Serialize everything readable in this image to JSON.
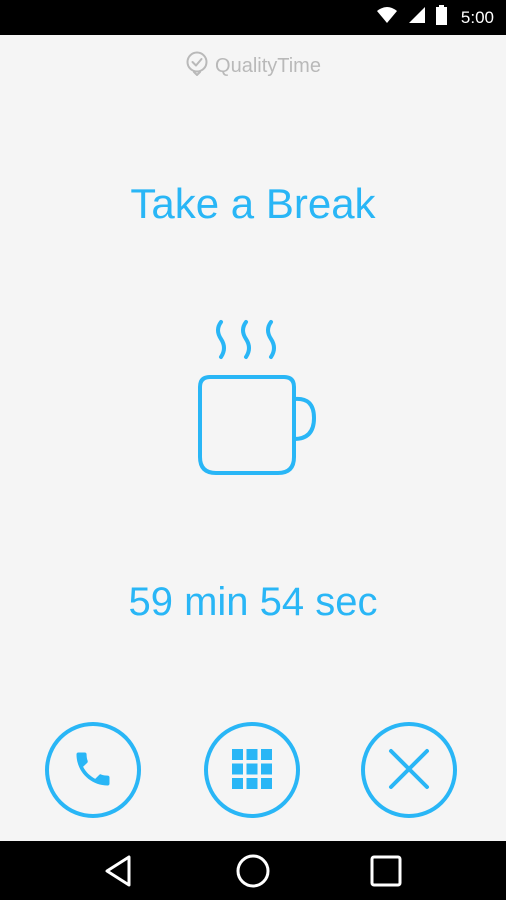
{
  "status_bar": {
    "time": "5:00",
    "icons": [
      "wifi-icon",
      "cell-signal-icon",
      "battery-icon"
    ]
  },
  "brand": {
    "name": "QualityTime",
    "icon": "clock-check-icon"
  },
  "break_screen": {
    "title": "Take a Break",
    "illustration": "coffee-cup-icon",
    "timer": "59 min 54 sec"
  },
  "actions": [
    {
      "name": "call-button",
      "icon": "phone-icon"
    },
    {
      "name": "apps-button",
      "icon": "grid-icon"
    },
    {
      "name": "close-button",
      "icon": "close-icon"
    }
  ],
  "navigation": [
    "back-icon",
    "home-icon",
    "recents-icon"
  ],
  "colors": {
    "accent": "#29b6f6",
    "background": "#f5f5f5",
    "brand_gray": "#b9b9b9",
    "bars": "#000000"
  }
}
